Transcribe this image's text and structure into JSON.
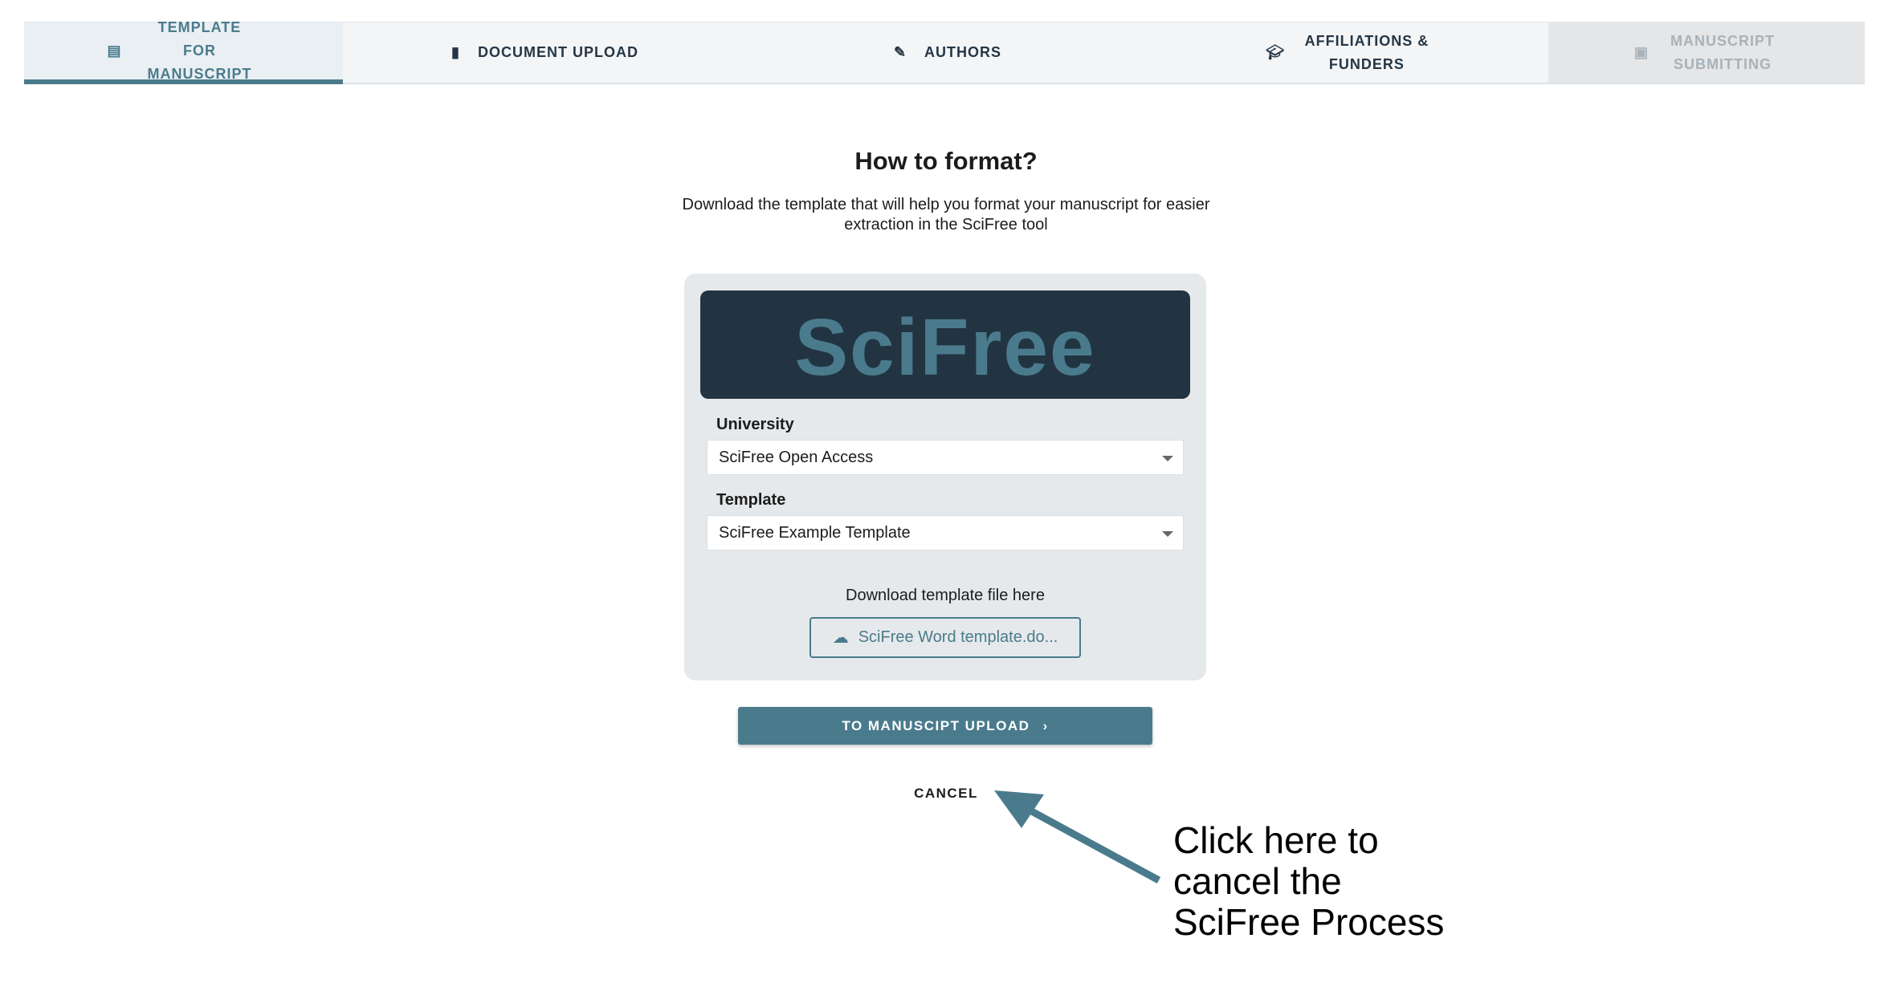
{
  "tabs": [
    {
      "label": "TEMPLATE FOR MANUSCRIPT",
      "icon": "list-icon",
      "state": "active"
    },
    {
      "label": "DOCUMENT UPLOAD",
      "icon": "file-icon",
      "state": "default"
    },
    {
      "label": "AUTHORS",
      "icon": "pencil-icon",
      "state": "default"
    },
    {
      "label": "AFFILIATIONS & FUNDERS",
      "icon": "graduation-cap-icon",
      "state": "default"
    },
    {
      "label": "MANUSCRIPT SUBMITTING",
      "icon": "form-icon",
      "state": "disabled"
    }
  ],
  "main": {
    "title": "How to format?",
    "description": "Download the template that will help you format your manuscript for easier extraction in the SciFree tool",
    "logo": "SciFree",
    "university_label": "University",
    "university_value": "SciFree Open Access",
    "template_label": "Template",
    "template_value": "SciFree Example Template",
    "download_text": "Download template file here",
    "download_button": "SciFree Word template.do...",
    "next_button": "TO MANUSCIPT UPLOAD",
    "cancel": "CANCEL"
  },
  "annotation": "Click here to cancel the SciFree Process",
  "colors": {
    "accent": "#4a7b8c",
    "dark": "#223442"
  }
}
